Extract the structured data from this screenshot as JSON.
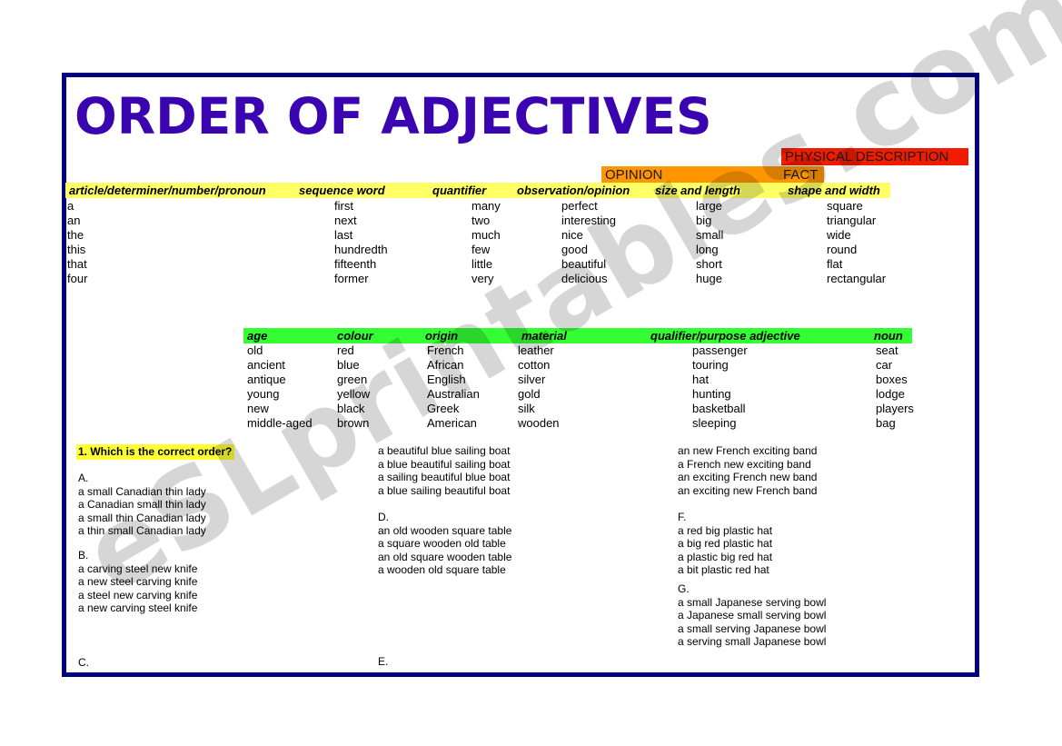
{
  "title": "ORDER OF ADJECTIVES",
  "watermark": "eSLprintables.com",
  "colors": {
    "frame": "#000080",
    "title": "#3a04b0",
    "banner_red": "#f01c00",
    "banner_orange": "#ff9500",
    "header_yellow": "#ffff66",
    "header_green": "#33ff33",
    "question_highlight": "#ffff33"
  },
  "banners": {
    "physical_description": "PHYSICAL DESCRIPTION",
    "opinion": "OPINION",
    "fact": "FACT"
  },
  "table_one": {
    "columns": [
      {
        "header": "article/determiner/number/pronoun",
        "words": [
          "a",
          "an",
          "the",
          "this",
          "that",
          "four"
        ]
      },
      {
        "header": "sequence word",
        "words": [
          "first",
          "next",
          "last",
          "hundredth",
          "fifteenth",
          "former"
        ]
      },
      {
        "header": "quantifier",
        "words": [
          "many",
          "two",
          "much",
          "few",
          "little",
          "very"
        ]
      },
      {
        "header": "observation/opinion",
        "words": [
          "perfect",
          "interesting",
          "nice",
          "good",
          "beautiful",
          "delicious"
        ]
      },
      {
        "header": "size and length",
        "words": [
          "large",
          "big",
          "small",
          "long",
          "short",
          "huge"
        ]
      },
      {
        "header": "shape and width",
        "words": [
          "square",
          "triangular",
          "wide",
          "round",
          "flat",
          "rectangular"
        ]
      }
    ]
  },
  "table_two": {
    "columns": [
      {
        "header": "age",
        "words": [
          "old",
          "ancient",
          "antique",
          "young",
          "new",
          "middle-aged"
        ]
      },
      {
        "header": "colour",
        "words": [
          "red",
          "blue",
          "green",
          "yellow",
          "black",
          "brown"
        ]
      },
      {
        "header": "origin",
        "words": [
          "French",
          "African",
          "English",
          "Australian",
          "Greek",
          "American"
        ]
      },
      {
        "header": "material",
        "words": [
          "leather",
          "cotton",
          "silver",
          "gold",
          "silk",
          "wooden"
        ]
      },
      {
        "header": "qualifier/purpose adjective",
        "words": [
          "passenger",
          "touring",
          "hat",
          "hunting",
          "basketball",
          "sleeping"
        ]
      },
      {
        "header": "noun",
        "words": [
          "seat",
          "car",
          "boxes",
          "lodge",
          "players",
          "bag"
        ]
      }
    ]
  },
  "exercise": {
    "question": "1. Which is the correct order?",
    "blocks": {
      "a": {
        "letter": "A.",
        "items": [
          "a small Canadian thin lady",
          "a Canadian small thin lady",
          "a small thin Canadian lady",
          "a thin small Canadian lady"
        ]
      },
      "b": {
        "letter": "B.",
        "items": [
          "a carving steel new knife",
          "a new steel carving knife",
          "a steel new carving knife",
          "a new carving steel knife"
        ]
      },
      "c": {
        "letter": "C.",
        "items": []
      },
      "boat": {
        "items": [
          "a beautiful blue sailing boat",
          "a blue beautiful sailing boat",
          "a sailing beautiful blue boat",
          "a blue sailing beautiful boat"
        ]
      },
      "d": {
        "letter": "D.",
        "items": [
          "an old wooden square table",
          "a square wooden old table",
          "an old square wooden table",
          "a wooden old square table"
        ]
      },
      "e": {
        "letter": "E.",
        "items": []
      },
      "band": {
        "items": [
          "an new French exciting band",
          "a French new exciting band",
          "an exciting French new band",
          "an exciting new French band"
        ]
      },
      "f": {
        "letter": "F.",
        "items": [
          "a red big plastic hat",
          "a big red plastic hat",
          "a plastic big red hat",
          "a bit plastic red hat"
        ]
      },
      "g": {
        "letter": "G.",
        "items": [
          "a small Japanese serving bowl",
          "a Japanese small serving bowl",
          "a small serving Japanese bowl",
          "a serving small Japanese bowl"
        ]
      }
    }
  }
}
